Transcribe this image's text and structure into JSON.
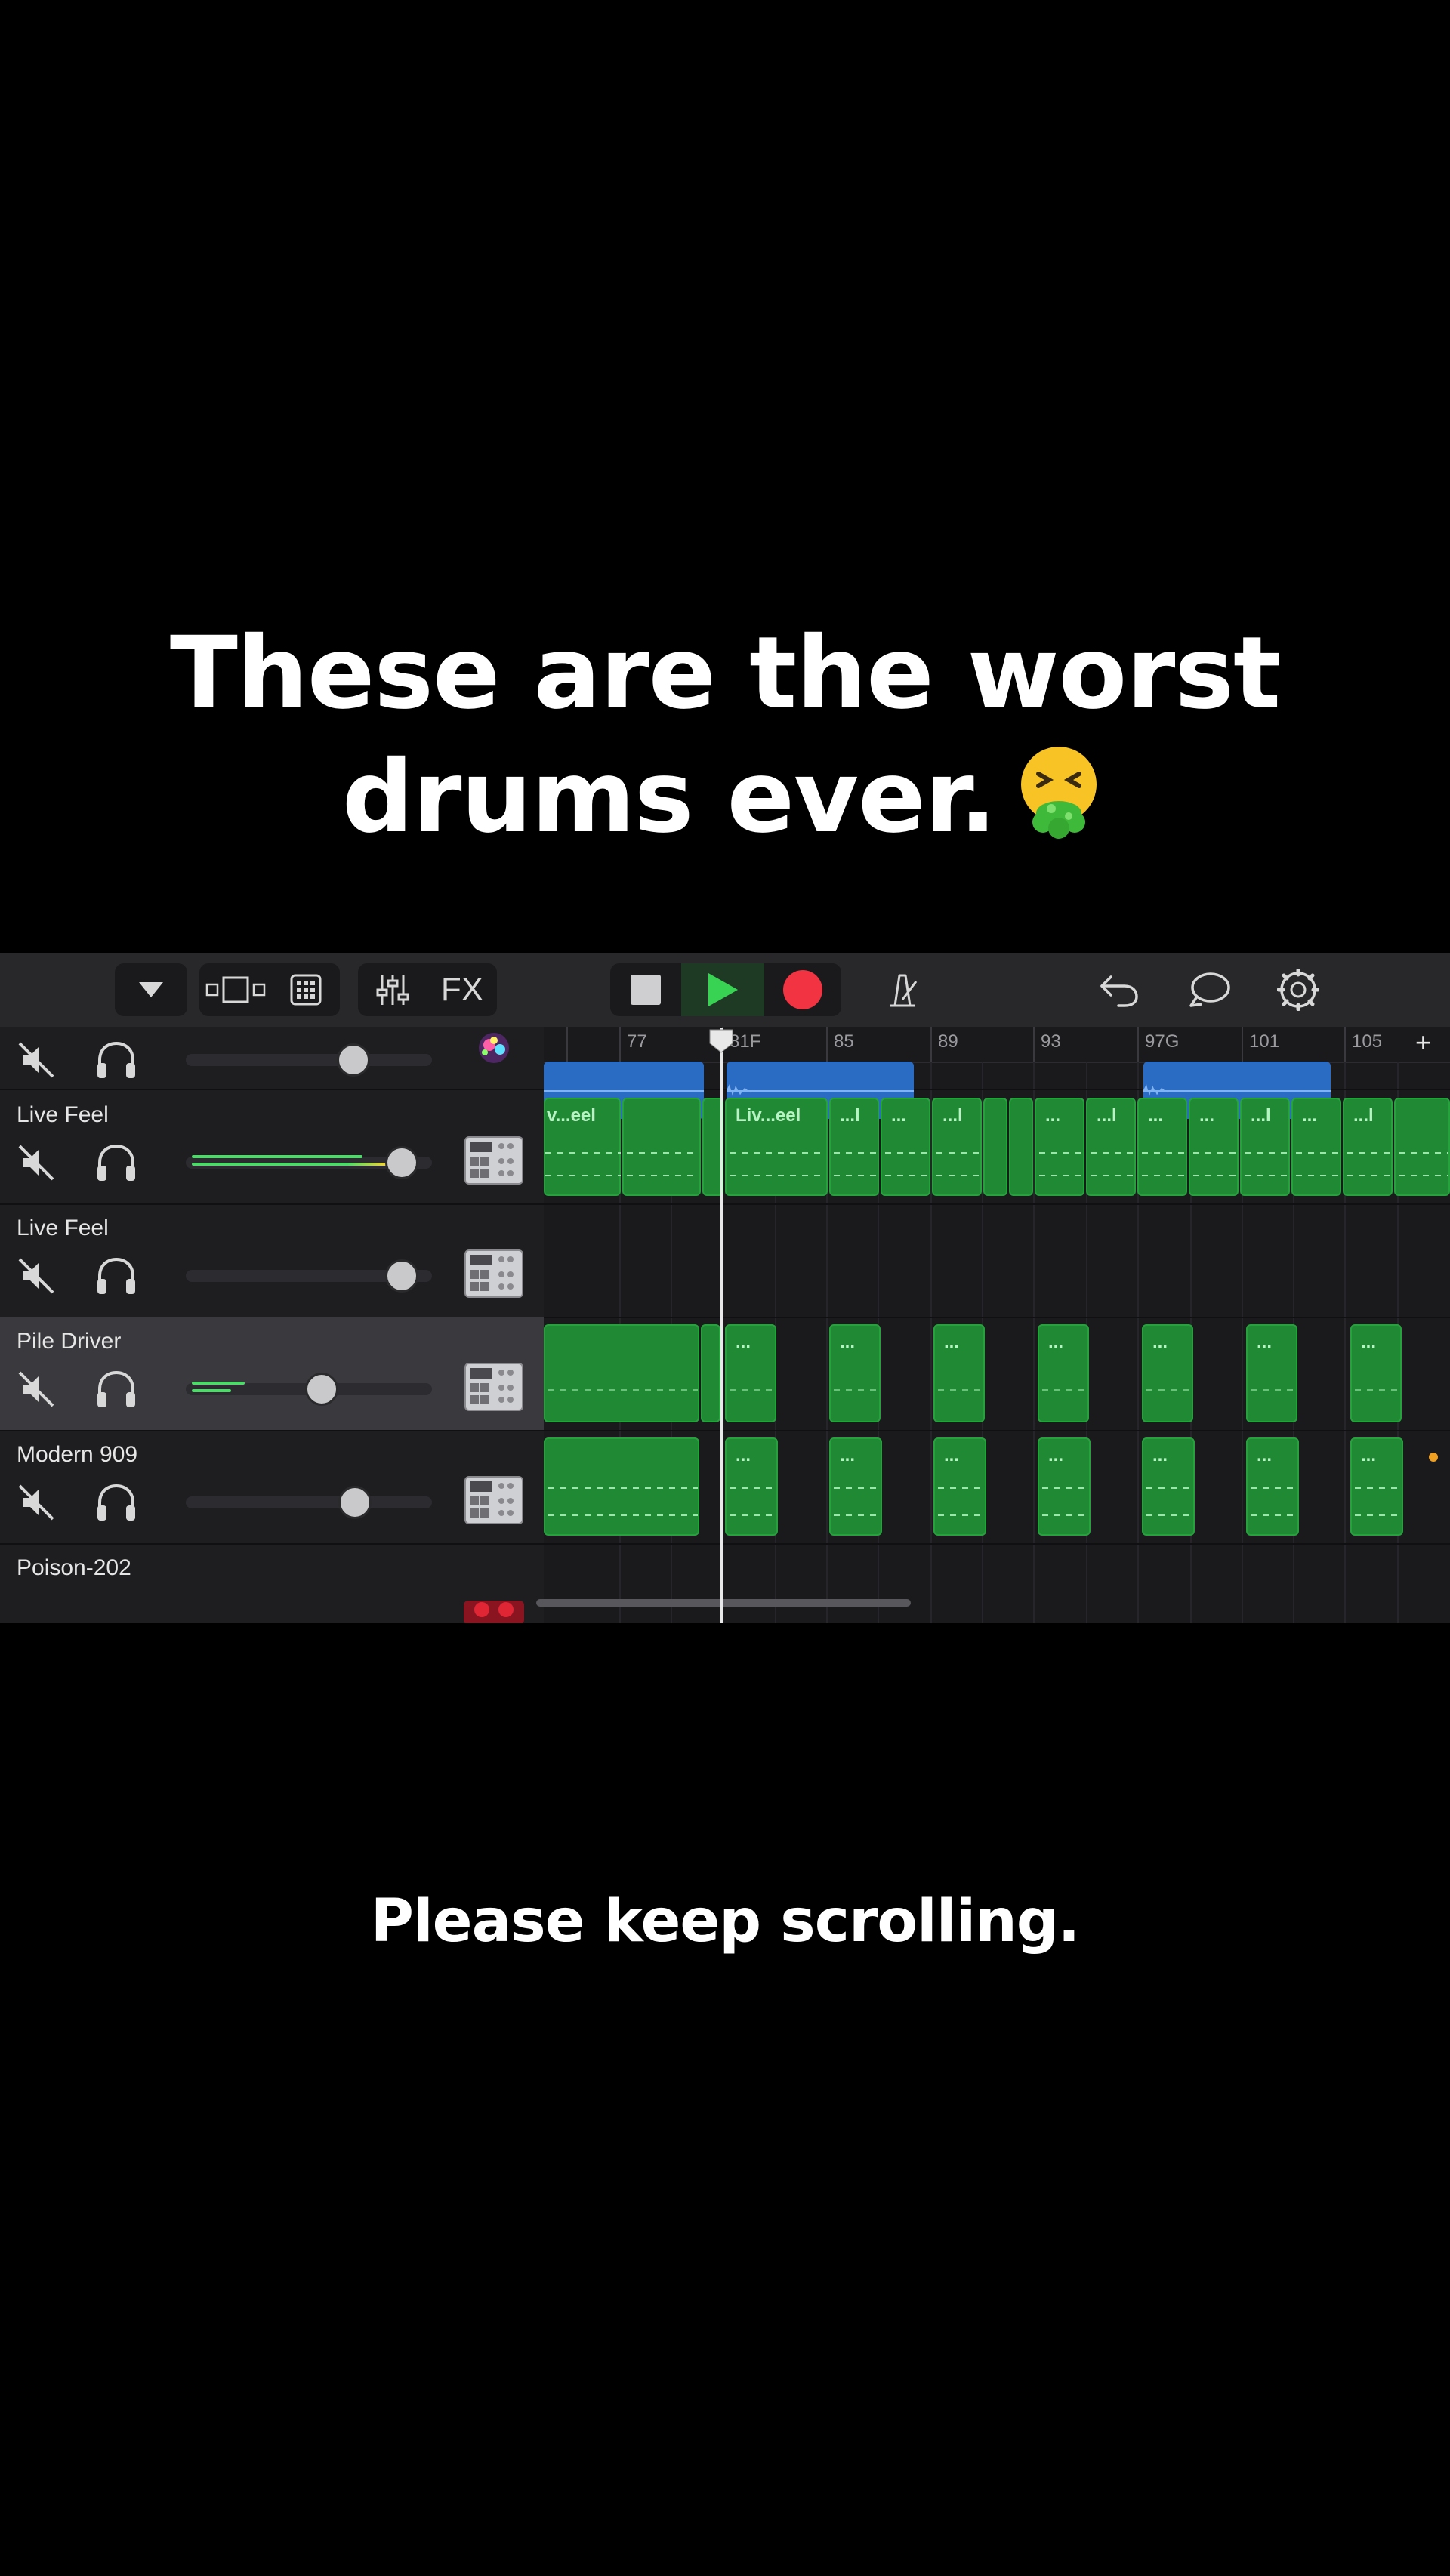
{
  "captions": {
    "top_line1": "These are the worst",
    "top_line2": "drums ever.",
    "top_emoji": "vomiting-face-emoji",
    "bottom": "Please keep scrolling."
  },
  "toolbar": {
    "browser_icon": "triangle-down-icon",
    "view_icon": "tracks-view-icon",
    "grid_icon": "grid-icon",
    "mixer_icon": "mixer-sliders-icon",
    "fx_label": "FX",
    "stop_icon": "stop-icon",
    "play_icon": "play-icon",
    "record_icon": "record-icon",
    "metronome_icon": "metronome-icon",
    "undo_icon": "undo-icon",
    "loop_icon": "loop-icon",
    "settings_icon": "gear-icon",
    "colors": {
      "play": "#39d353",
      "record": "#f23341"
    }
  },
  "ruler": {
    "bars": [
      "77",
      "81F",
      "85",
      "89",
      "93",
      "97G",
      "101",
      "105"
    ],
    "add_label": "+"
  },
  "tracks": [
    {
      "name": "",
      "volume": 0.8,
      "meter": 0,
      "instrument": "sparkle-instrument-icon",
      "selected": false
    },
    {
      "name": "Live Feel",
      "volume": 0.9,
      "meter": 0.8,
      "instrument": "drum-machine-icon",
      "selected": false
    },
    {
      "name": "Live Feel",
      "volume": 0.9,
      "meter": 0,
      "instrument": "drum-machine-icon",
      "selected": false
    },
    {
      "name": "Pile Driver",
      "volume": 0.57,
      "meter": 0.2,
      "instrument": "drum-machine-icon",
      "selected": true
    },
    {
      "name": "Modern 909",
      "volume": 0.72,
      "meter": 0,
      "instrument": "drum-machine-icon",
      "selected": false
    },
    {
      "name": "Poison-202",
      "volume": 0,
      "meter": 0,
      "instrument": "synth-instrument-icon",
      "selected": false
    }
  ],
  "region_labels": {
    "live_feel_a": "v...eel",
    "live_feel_b": "Liv...eel",
    "short": "...l",
    "dots": "..."
  }
}
